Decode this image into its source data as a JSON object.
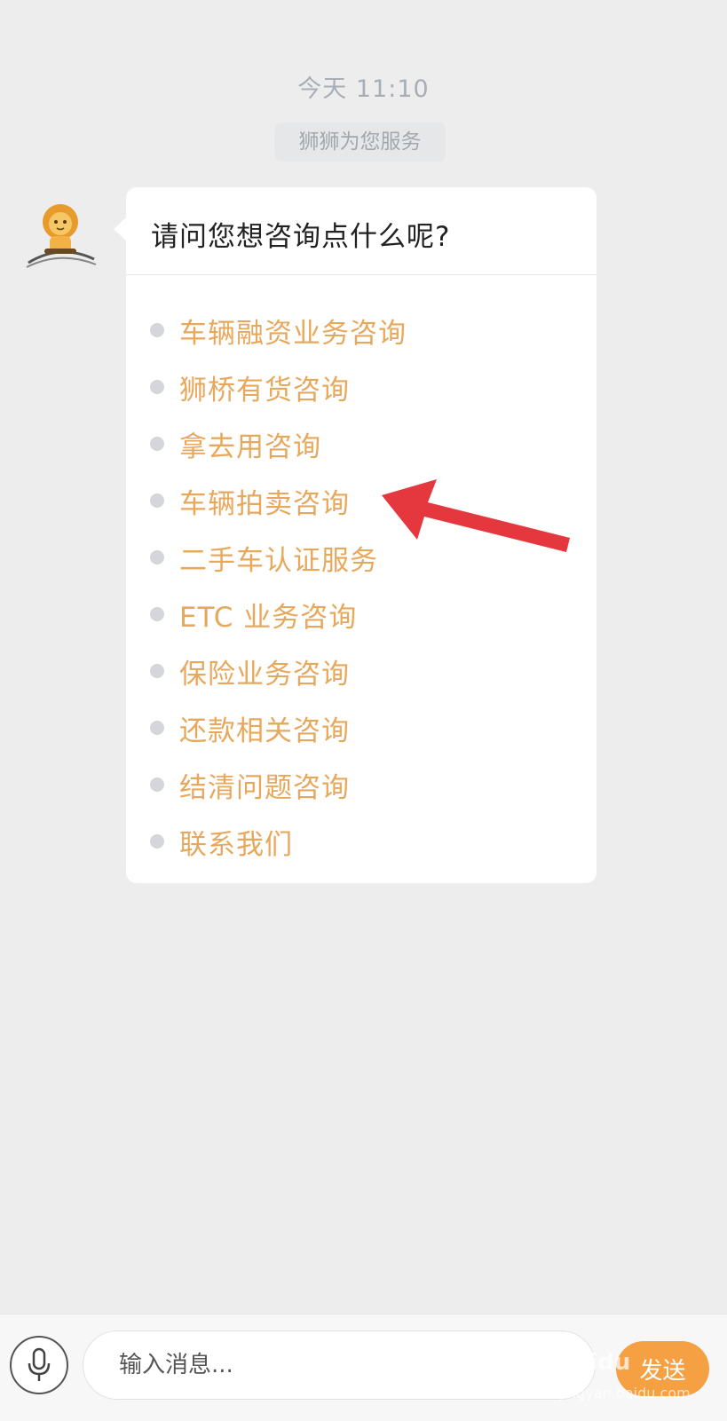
{
  "chat": {
    "timestamp": "今天 11:10",
    "service_notice": "狮狮为您服务",
    "question": "请问您想咨询点什么呢?",
    "options": [
      {
        "label": "车辆融资业务咨询"
      },
      {
        "label": "狮桥有货咨询"
      },
      {
        "label": "拿去用咨询"
      },
      {
        "label": "车辆拍卖咨询"
      },
      {
        "label": "二手车认证服务"
      },
      {
        "label": "ETC 业务咨询"
      },
      {
        "label": "保险业务咨询"
      },
      {
        "label": "还款相关咨询"
      },
      {
        "label": "结清问题咨询"
      },
      {
        "label": "联系我们"
      }
    ]
  },
  "annotation": {
    "icon": "red-arrow-icon",
    "color": "#e5383e"
  },
  "input_bar": {
    "mic_icon": "microphone-icon",
    "placeholder": "输入消息...",
    "send_label": "发送"
  },
  "watermark": {
    "text": "Baidu",
    "sub": "jingyan.baidu.com"
  },
  "colors": {
    "accent": "#f5a043",
    "option_text": "#e7a85c",
    "background": "#ededed"
  }
}
